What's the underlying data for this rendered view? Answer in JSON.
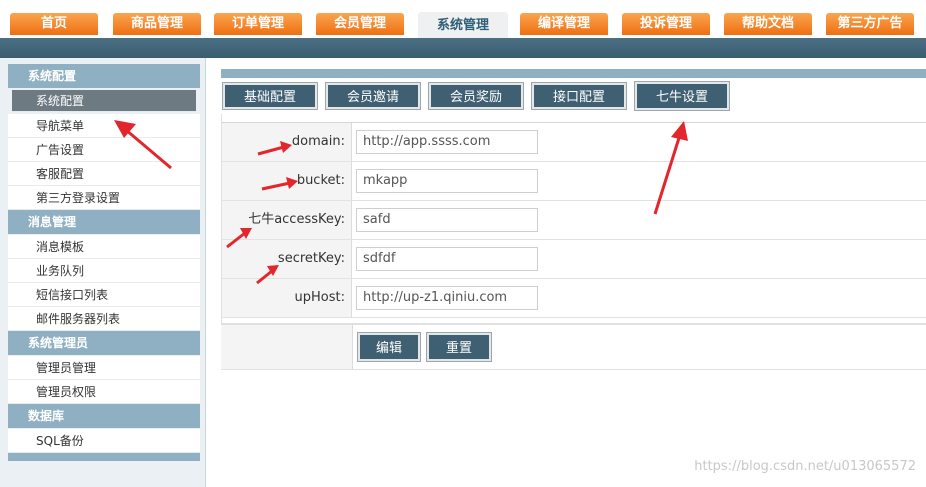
{
  "top_nav": {
    "tabs": [
      {
        "label": "首页"
      },
      {
        "label": "商品管理"
      },
      {
        "label": "订单管理"
      },
      {
        "label": "会员管理"
      },
      {
        "label": "系统管理",
        "active": true
      },
      {
        "label": "编译管理"
      },
      {
        "label": "投诉管理"
      },
      {
        "label": "帮助文档"
      },
      {
        "label": "第三方广告"
      }
    ]
  },
  "sidebar": {
    "groups": [
      {
        "title": "系统配置",
        "items": [
          "系统配置",
          "导航菜单",
          "广告设置",
          "客服配置",
          "第三方登录设置"
        ]
      },
      {
        "title": "消息管理",
        "items": [
          "消息模板",
          "业务队列",
          "短信接口列表",
          "邮件服务器列表"
        ]
      },
      {
        "title": "系统管理员",
        "items": [
          "管理员管理",
          "管理员权限"
        ]
      },
      {
        "title": "数据库",
        "items": [
          "SQL备份"
        ]
      }
    ]
  },
  "sub_tabs": [
    "基础配置",
    "会员邀请",
    "会员奖励",
    "接口配置",
    "七牛设置"
  ],
  "form": {
    "fields": [
      {
        "label": "domain:",
        "value": "http://app.ssss.com"
      },
      {
        "label": "bucket:",
        "value": "mkapp"
      },
      {
        "label": "七牛accessKey:",
        "value": "safd"
      },
      {
        "label": "secretKey:",
        "value": "sdfdf"
      },
      {
        "label": "upHost:",
        "value": "http://up-z1.qiniu.com"
      }
    ],
    "edit_label": "编辑",
    "reset_label": "重置"
  },
  "watermark": "https://blog.csdn.net/u013065572",
  "colors": {
    "nav_orange": "#f28a2c",
    "header_band": "#416577",
    "sidebar_head": "#8fb0c3",
    "button": "#3f5f72",
    "annotation_red": "#e3262c"
  }
}
